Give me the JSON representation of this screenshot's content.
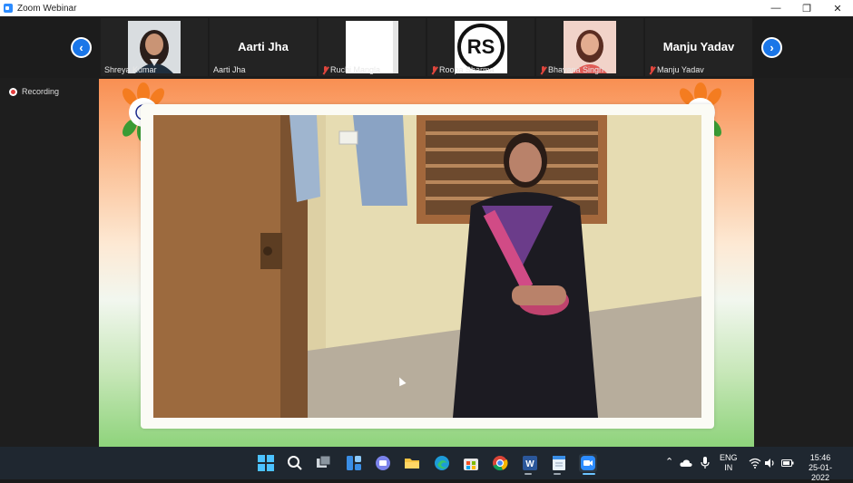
{
  "window": {
    "title": "Zoom Webinar",
    "minimize": "—",
    "restore": "❐",
    "close": "✕"
  },
  "participants": [
    {
      "name": "Shreya Kumar",
      "muted": false
    },
    {
      "name": "Aarti Jha",
      "muted": false,
      "display": "Aarti Jha"
    },
    {
      "name": "Ruchi Mangla",
      "muted": true
    },
    {
      "name": "Roopa Sharma",
      "muted": true,
      "avatar_text": "RS"
    },
    {
      "name": "Bhavana Singh",
      "muted": true
    },
    {
      "name": "Manju Yadav",
      "muted": true,
      "display": "Manju Yadav"
    }
  ],
  "nav": {
    "prev": "‹",
    "next": "›"
  },
  "recording": {
    "label": "Recording"
  },
  "colors": {
    "accent": "#2d8cff",
    "nav": "#1a76e8",
    "muted": "#e0463d",
    "taskbar": "#1f2730"
  },
  "taskbar": {
    "apps": [
      "start-icon",
      "search-icon",
      "task-view-icon",
      "widgets-icon",
      "chat-icon",
      "file-explorer-icon",
      "edge-icon",
      "store-icon",
      "chrome-icon",
      "word-icon",
      "notepad-icon",
      "zoom-icon"
    ],
    "language": "ENG",
    "region": "IN",
    "time": "15:46",
    "date": "25-01-2022"
  }
}
